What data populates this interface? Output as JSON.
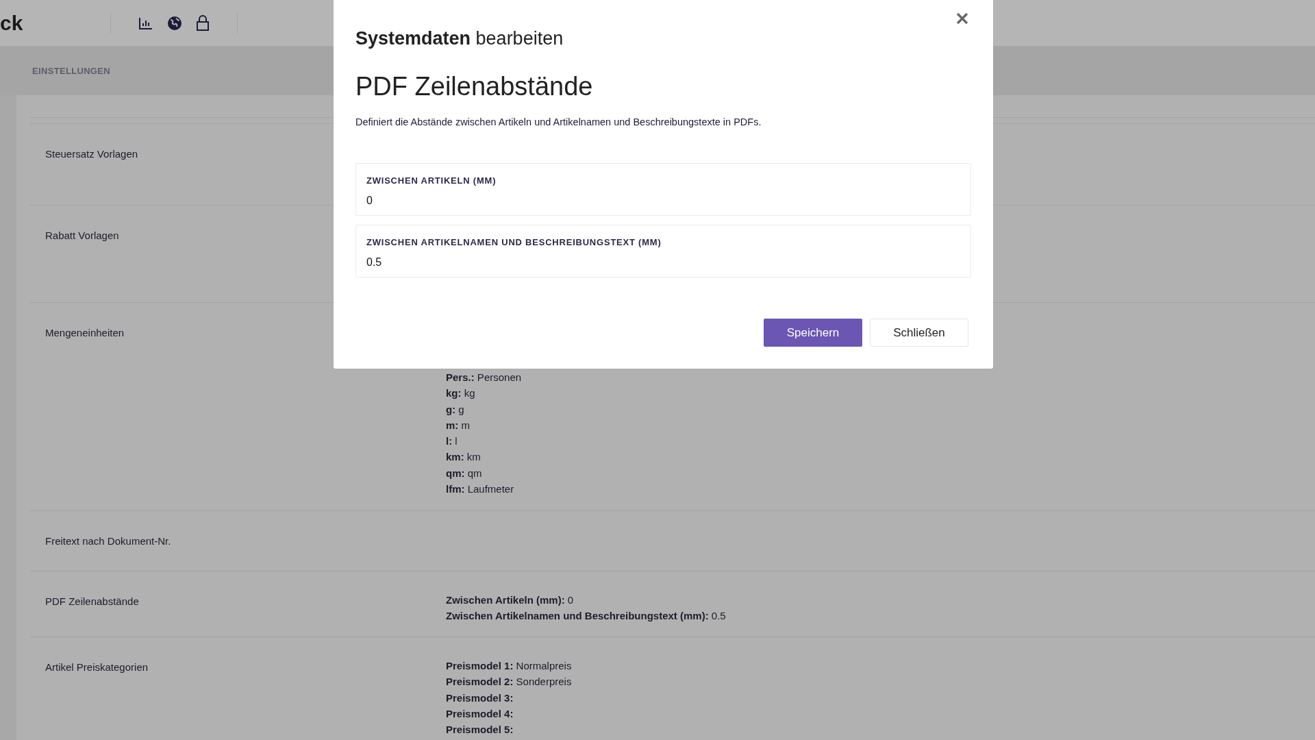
{
  "header": {
    "logo": "ck"
  },
  "subheader": {
    "title": "EINSTELLUNGEN"
  },
  "settings": [
    {
      "label": "Steuersatz Vorlagen"
    },
    {
      "label": "Rabatt Vorlagen"
    },
    {
      "label": "Mengeneinheiten",
      "values": [
        {
          "key": "Pers.:",
          "value": "Personen"
        },
        {
          "key": "kg:",
          "value": "kg"
        },
        {
          "key": "g:",
          "value": "g"
        },
        {
          "key": "m:",
          "value": "m"
        },
        {
          "key": "l:",
          "value": "l"
        },
        {
          "key": "km:",
          "value": "km"
        },
        {
          "key": "qm:",
          "value": "qm"
        },
        {
          "key": "lfm:",
          "value": "Laufmeter"
        }
      ]
    },
    {
      "label": "Freitext nach Dokument-Nr."
    },
    {
      "label": "PDF Zeilenabstände",
      "values": [
        {
          "key": "Zwischen Artikeln (mm):",
          "value": "0"
        },
        {
          "key": "Zwischen Artikelnamen und Beschreibungstext (mm):",
          "value": "0.5"
        }
      ]
    },
    {
      "label": "Artikel Preiskategorien",
      "values": [
        {
          "key": "Preismodel 1:",
          "value": "Normalpreis"
        },
        {
          "key": "Preismodel 2:",
          "value": "Sonderpreis"
        },
        {
          "key": "Preismodel 3:"
        },
        {
          "key": "Preismodel 4:"
        },
        {
          "key": "Preismodel 5:"
        }
      ]
    }
  ],
  "dialog": {
    "title": "**Systemdaten** bearbeiten",
    "heading": "PDF Zeilenabstände",
    "description": "Definiert die Abstände zwischen Artikeln und Artikelnamen und Beschreibungstexte in PDFs.",
    "fields": [
      {
        "label": "ZWISCHEN ARTIKELN (MM)",
        "value": "0"
      },
      {
        "label": "ZWISCHEN ARTIKELNAMEN UND BESCHREIBUNGSTEXT (MM)",
        "value": "0.5"
      }
    ],
    "buttons": [
      {
        "label": "Speichern",
        "kind": "primary"
      },
      {
        "label": "Schließen",
        "kind": "secondary"
      }
    ]
  }
}
